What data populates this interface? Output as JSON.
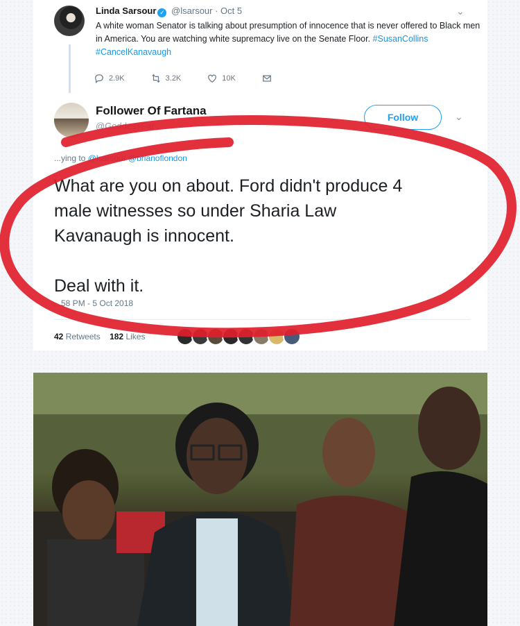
{
  "tweet1": {
    "name": "Linda Sarsour",
    "handle": "@lsarsour",
    "time": "· Oct 5",
    "text": "A white woman Senator is talking about presumption of innocence that is never offered to Black men in America. You are watching white supremacy live on the Senate Floor.",
    "hashtags": [
      "#SusanCollins",
      "#CancelKanavaugh"
    ],
    "replies": "2.9K",
    "retweets": "3.2K",
    "likes": "10K"
  },
  "tweet2": {
    "name": "Follower Of Fartana",
    "handle": "@GoddessFar",
    "follow_label": "Follow",
    "replying_prefix": "...ying to",
    "mentions": [
      "@lsarsour",
      "@brianoflondon"
    ],
    "text_lines": [
      "What are you on about. Ford didn't produce 4",
      "male witnesses so under Sharia Law",
      "Kavanaugh is innocent.",
      "Deal with it."
    ],
    "timestamp": "...58 PM - 5 Oct 2018",
    "retweets_count": "42",
    "retweets_label": "Retweets",
    "likes_count": "182",
    "likes_label": "Likes"
  },
  "colors": {
    "twitter_blue": "#1da1f2",
    "circle_red": "#e0202c"
  }
}
